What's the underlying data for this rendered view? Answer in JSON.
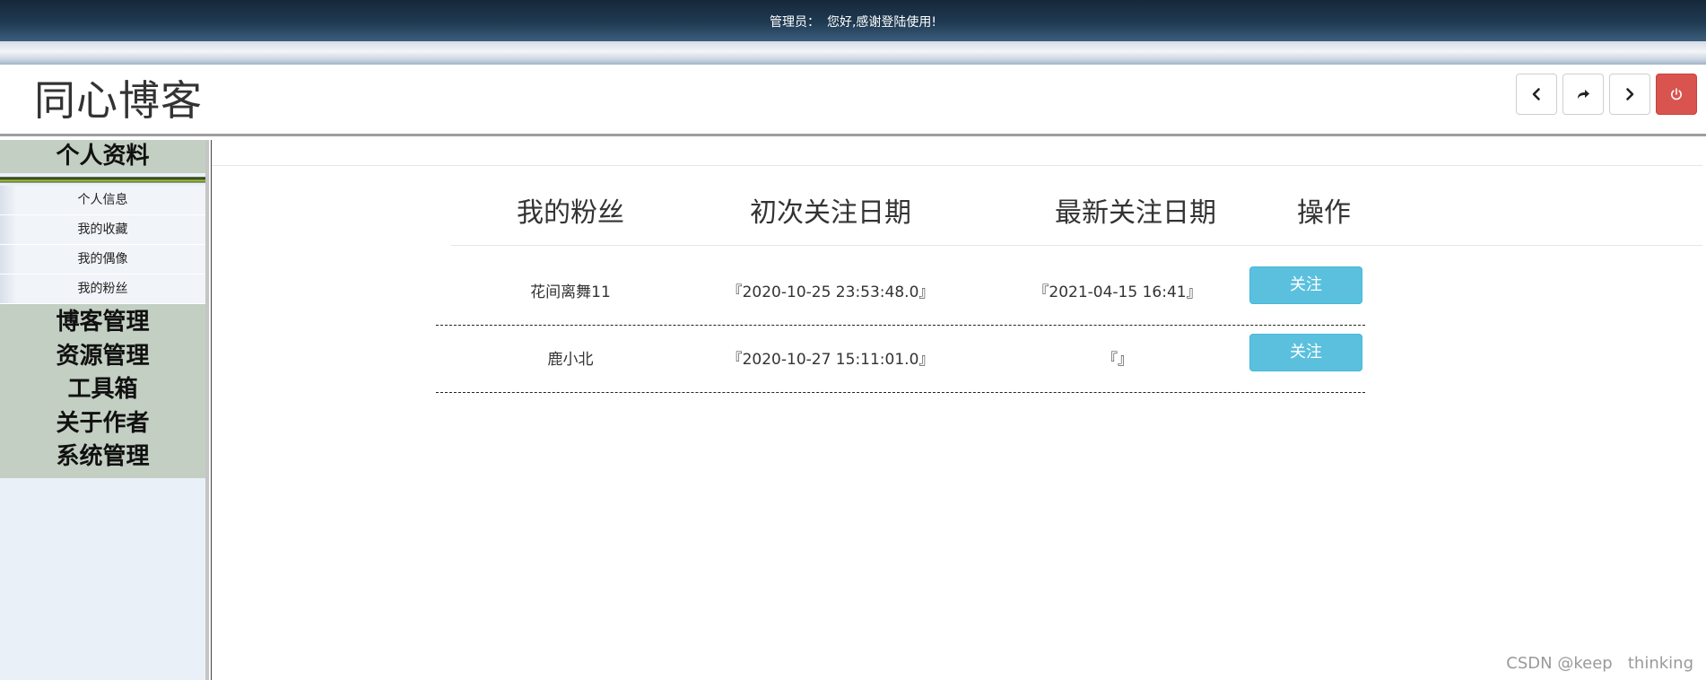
{
  "topbar": {
    "role_label": "管理员：",
    "welcome_text": "您好,感谢登陆使用!"
  },
  "header": {
    "site_title": "同心博客",
    "buttons": [
      {
        "name": "back-button",
        "icon": "chevron-left-icon"
      },
      {
        "name": "share-button",
        "icon": "share-arrow-icon"
      },
      {
        "name": "forward-button",
        "icon": "chevron-right-icon"
      },
      {
        "name": "logout-button",
        "icon": "power-icon"
      }
    ]
  },
  "sidebar": {
    "group_title": "个人资料",
    "sub_items": [
      {
        "label": "个人信息"
      },
      {
        "label": "我的收藏"
      },
      {
        "label": "我的偶像"
      },
      {
        "label": "我的粉丝"
      }
    ],
    "main_items": [
      {
        "label": "博客管理"
      },
      {
        "label": "资源管理"
      },
      {
        "label": "工具箱"
      },
      {
        "label": "关于作者"
      },
      {
        "label": "系统管理"
      }
    ]
  },
  "table": {
    "columns": [
      "我的粉丝",
      "初次关注日期",
      "最新关注日期",
      "操作"
    ],
    "rows": [
      {
        "fan": "花间离舞11",
        "first_date": "『2020-10-25 23:53:48.0』",
        "latest_date": "『2021-04-15 16:41』",
        "action": "关注"
      },
      {
        "fan": "鹿小北",
        "first_date": "『2020-10-27 15:11:01.0』",
        "latest_date": "『』",
        "action": "关注"
      }
    ]
  },
  "watermark": "CSDN @keep   thinking",
  "colors": {
    "topbar": "#1f3a52",
    "sidebar_head": "#c3cfc3",
    "follow_button": "#5bc0de",
    "logout_button": "#d9534f"
  }
}
